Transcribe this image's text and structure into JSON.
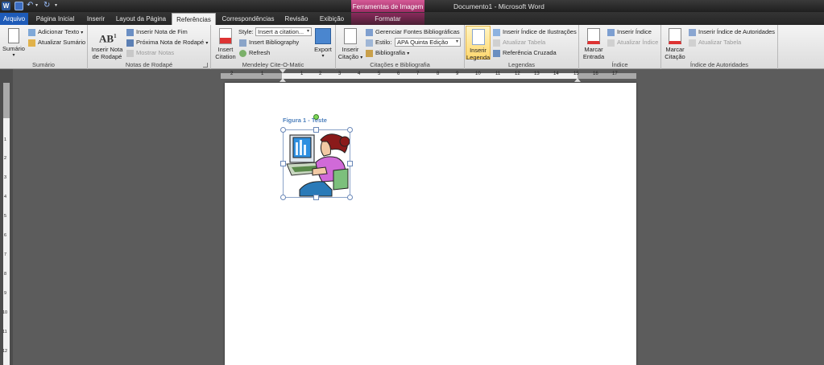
{
  "app": {
    "document_title": "Documento1",
    "app_name": "Microsoft Word",
    "separator": "-"
  },
  "context_tab": {
    "header": "Ferramentas de Imagem",
    "tab": "Formatar"
  },
  "tabs": [
    "Arquivo",
    "Página Inicial",
    "Inserir",
    "Layout da Página",
    "Referências",
    "Correspondências",
    "Revisão",
    "Exibição"
  ],
  "active_tab": "Referências",
  "ribbon": {
    "sumario": {
      "label": "Sumário",
      "big": "Sumário",
      "add_text": "Adicionar Texto",
      "update": "Atualizar Sumário"
    },
    "notas": {
      "label": "Notas de Rodapé",
      "big1": "Inserir Nota",
      "big2": "de Rodapé",
      "end_note": "Inserir Nota de Fim",
      "next_note": "Próxima Nota de Rodapé",
      "show_notes": "Mostrar Notas",
      "ab_glyph": "AB",
      "ab_sup": "1"
    },
    "mendeley": {
      "label": "Mendeley Cite-O-Matic",
      "insert1": "Insert",
      "insert2": "Citation",
      "style_label": "Style:",
      "style_value": "Insert a citation...",
      "bibliography": "Insert Bibliography",
      "refresh": "Refresh",
      "export": "Export"
    },
    "citacoes": {
      "label": "Citações e Bibliografia",
      "big1": "Inserir",
      "big2": "Citação",
      "manage": "Gerenciar Fontes Bibliográficas",
      "style_label": "Estilo:",
      "style_value": "APA Quinta Edição",
      "bibliography": "Bibliografia"
    },
    "legendas": {
      "label": "Legendas",
      "big1": "Inserir",
      "big2": "Legenda",
      "insert_index": "Inserir Índice de Ilustrações",
      "update_table": "Atualizar Tabela",
      "cross_ref": "Referência Cruzada"
    },
    "indice": {
      "label": "Índice",
      "big1": "Marcar",
      "big2": "Entrada",
      "insert_index": "Inserir Índice",
      "update_index": "Atualizar Índice"
    },
    "autoridades": {
      "label": "Índice de Autoridades",
      "big1": "Marcar",
      "big2": "Citação",
      "insert": "Inserir Índice de Autoridades",
      "update": "Atualizar Tabela"
    }
  },
  "ruler": {
    "ticks": [
      "2",
      "1",
      "1",
      "2",
      "3",
      "4",
      "5",
      "6",
      "7",
      "8",
      "9",
      "10",
      "11",
      "12",
      "13",
      "14",
      "15",
      "16",
      "17"
    ],
    "vticks": [
      "1",
      "2",
      "3",
      "4",
      "5",
      "6",
      "7",
      "8",
      "9",
      "10",
      "11",
      "12"
    ],
    "tab_marker": "L"
  },
  "document": {
    "caption": "Figura 1 - Teste",
    "image": "clipart-woman-at-computer"
  },
  "colors": {
    "accent": "#2b579a",
    "file_tab": "#1e5bb8",
    "context": "#c0417f",
    "caption": "#4f81bd"
  }
}
